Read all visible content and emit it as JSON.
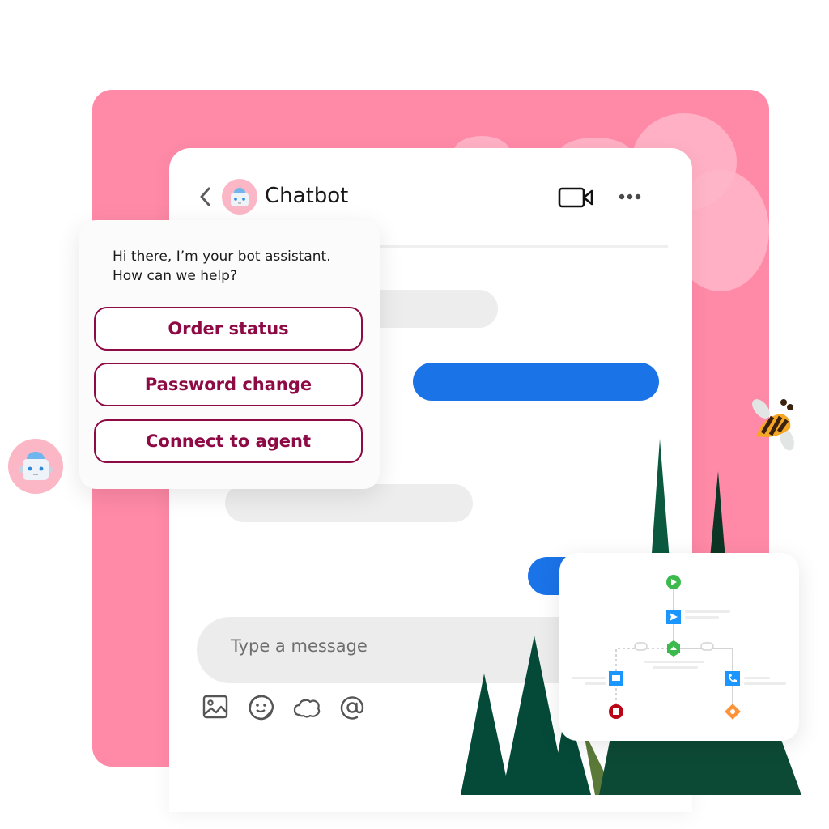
{
  "chat": {
    "title": "Chatbot",
    "back_icon": "chevron-left-icon",
    "video_icon": "video-camera-icon",
    "more_icon": "more-horizontal-icon",
    "input": {
      "placeholder": "Type a message",
      "value": ""
    },
    "toolbar": [
      {
        "icon": "image-icon"
      },
      {
        "icon": "sticker-emoji-icon"
      },
      {
        "icon": "cloud-icon"
      },
      {
        "icon": "at-mention-icon"
      }
    ]
  },
  "bot_popup": {
    "greeting_line1": "Hi there, I’m your bot assistant.",
    "greeting_line2": "How can we help?",
    "options": [
      {
        "label": "Order status"
      },
      {
        "label": "Password change"
      },
      {
        "label": "Connect to agent"
      }
    ]
  },
  "flow_diagram": {
    "nodes": [
      {
        "type": "start",
        "icon": "play-icon",
        "color": "#3dba4e"
      },
      {
        "type": "action",
        "icon": "send-icon",
        "color": "#1b96ff"
      },
      {
        "type": "decision",
        "icon": "decision-icon",
        "color": "#3dba4e"
      },
      {
        "type": "action",
        "icon": "email-icon",
        "color": "#1b96ff"
      },
      {
        "type": "action",
        "icon": "phone-icon",
        "color": "#1b96ff"
      },
      {
        "type": "end",
        "icon": "stop-icon",
        "color": "#ba0517"
      },
      {
        "type": "end",
        "icon": "phone-icon",
        "color": "#fe9339"
      }
    ]
  },
  "colors": {
    "accent_pink": "#ff8aa7",
    "button_maroon": "#8e0a45",
    "bubble_blue": "#1b73e8",
    "tree_green": "#054a38"
  }
}
